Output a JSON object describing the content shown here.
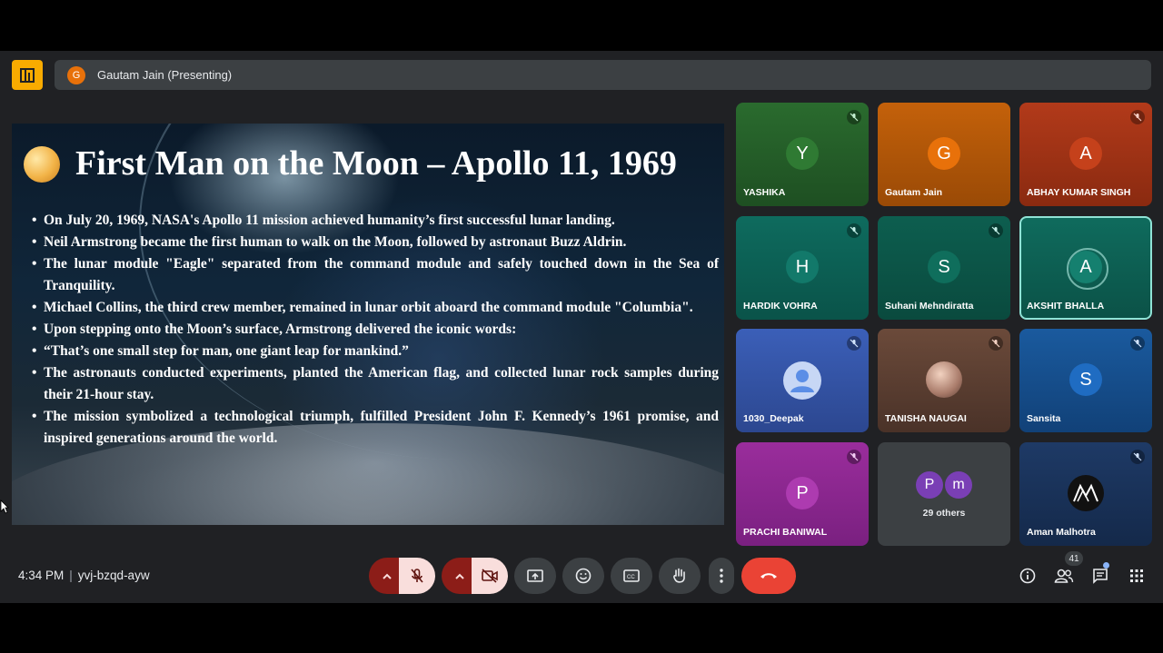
{
  "presenting": {
    "avatar_letter": "G",
    "label": "Gautam Jain (Presenting)"
  },
  "slide": {
    "title": "First Man on the Moon – Apollo 11, 1969",
    "bullets": [
      "On July 20, 1969, NASA's Apollo 11 mission achieved humanity’s first successful lunar landing.",
      "Neil Armstrong became the first human to walk on the Moon, followed by astronaut Buzz Aldrin.",
      "The lunar module \"Eagle\" separated from the command module and safely touched down in the Sea of Tranquility.",
      "Michael Collins, the third crew member, remained in lunar orbit aboard the command module \"Columbia\".",
      "Upon stepping onto the Moon’s surface, Armstrong delivered the iconic words:",
      "“That’s one small step for man, one giant leap for mankind.”",
      "The astronauts conducted experiments, planted the American flag, and collected lunar rock samples during their 21-hour stay.",
      "The mission symbolized a technological triumph, fulfilled President John F. Kennedy’s 1961 promise, and inspired generations around the world."
    ]
  },
  "participants": [
    {
      "letter": "Y",
      "name": "YASHIKA",
      "muted": true
    },
    {
      "letter": "G",
      "name": "Gautam Jain",
      "muted": false
    },
    {
      "letter": "A",
      "name": "ABHAY KUMAR SINGH",
      "muted": true
    },
    {
      "letter": "H",
      "name": "HARDIK VOHRA",
      "muted": true
    },
    {
      "letter": "S",
      "name": "Suhani Mehndiratta",
      "muted": true
    },
    {
      "letter": "A",
      "name": "AKSHIT BHALLA",
      "muted": false
    },
    {
      "letter": "",
      "name": "1030_Deepak",
      "muted": true
    },
    {
      "letter": "",
      "name": "TANISHA NAUGAI",
      "muted": true
    },
    {
      "letter": "S",
      "name": "Sansita",
      "muted": true
    },
    {
      "letter": "P",
      "name": "PRACHI BANIWAL",
      "muted": true
    },
    {
      "letter": "",
      "name": "Aman Malhotra",
      "muted": true
    }
  ],
  "others": {
    "avatars": [
      "P",
      "m"
    ],
    "label": "29 others"
  },
  "footer": {
    "time": "4:34 PM",
    "meeting_code": "yvj-bzqd-ayw",
    "people_count": "41"
  },
  "colors": {
    "end_call": "#ea4335",
    "muted_control_bg": "#f9dedc",
    "chevron_bg": "#8c1d18",
    "presenting_badge": "#f9ab00",
    "active_speaker_border": "#8fe3d6"
  }
}
